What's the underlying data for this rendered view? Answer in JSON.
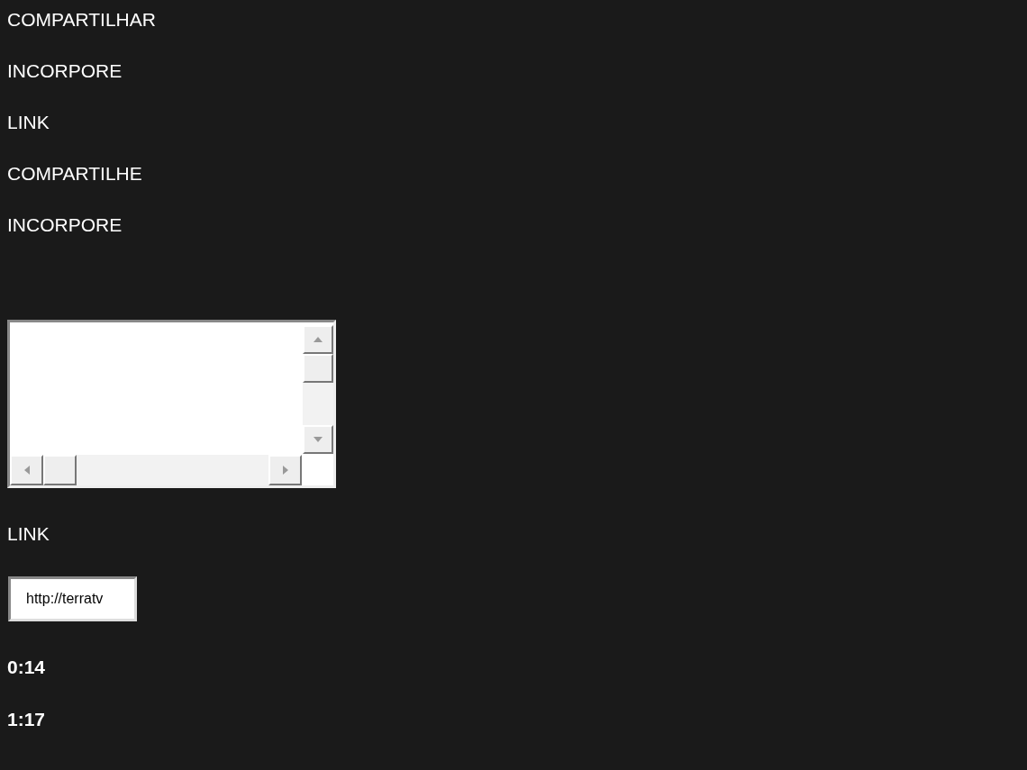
{
  "headings": [
    "COMPARTILHAR",
    "INCORPORE",
    "LINK",
    "COMPARTILHE",
    "INCORPORE"
  ],
  "embed_box": {
    "kind": "textarea"
  },
  "link_label": "LINK",
  "link_field": {
    "value": "http://terratv"
  },
  "times": [
    "0:14",
    "1:17"
  ]
}
